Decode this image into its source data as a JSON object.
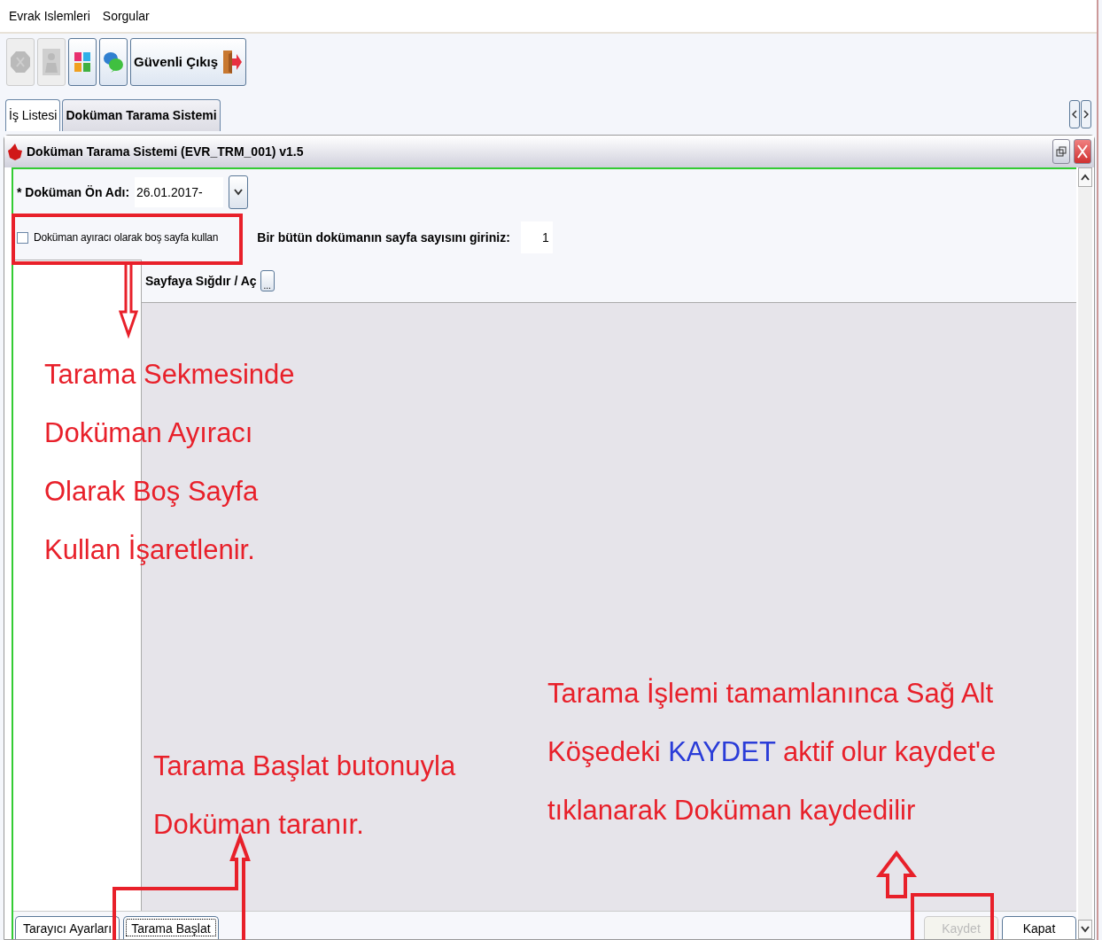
{
  "menu": [
    {
      "label": "Evrak Islemleri"
    },
    {
      "label": "Sorgular"
    }
  ],
  "toolbar": [
    {
      "kind": "icon",
      "disabled": true
    },
    {
      "kind": "icon",
      "disabled": true
    },
    {
      "kind": "icon",
      "disabled": false
    },
    {
      "kind": "icon",
      "disabled": false
    },
    {
      "kind": "labeled",
      "label": "Güvenli Çıkış",
      "disabled": false
    }
  ],
  "tabs": [
    {
      "label": "İş Listesi",
      "selected": false
    },
    {
      "label": "Doküman Tarama Sistemi",
      "selected": true
    }
  ],
  "window": {
    "title": "Doküman Tarama Sistemi (EVR_TRM_001) v1.5"
  },
  "form": {
    "prefix_label": "* Doküman Ön Adı:",
    "prefix_value": "26.01.2017-",
    "separator_checkbox": {
      "label": "Doküman ayıracı olarak boş sayfa kullan",
      "checked": false
    },
    "page_count_label": "Bir bütün dokümanın sayfa sayısını giriniz:",
    "page_count_value": "1",
    "fit_label": "Sayfaya Sığdır / Aç",
    "fit_button": "..."
  },
  "bottom_left_buttons": [
    {
      "label": "Tarayıcı Ayarları",
      "focused": false
    },
    {
      "label": "Tarama Başlat",
      "focused": true
    }
  ],
  "bottom_right_buttons": [
    {
      "label": "Kaydet",
      "disabled": true
    },
    {
      "label": "Kapat",
      "disabled": false
    }
  ],
  "annotations": [
    {
      "segments": [
        {
          "text": "Tarama Sekmesinde Doküman Ayıracı Olarak Boş Sayfa Kullan İşaretlenir.",
          "highlight": false
        }
      ]
    },
    {
      "segments": [
        {
          "text": "Tarama Başlat butonuyla Doküman taranır.",
          "highlight": false
        }
      ]
    },
    {
      "segments": [
        {
          "text": "Tarama İşlemi tamamlanınca Sağ Alt Köşedeki ",
          "highlight": false
        },
        {
          "text": "KAYDET",
          "highlight": true
        },
        {
          "text": " aktif olur kaydet'e tıklanarak Doküman kaydedilir",
          "highlight": false
        }
      ]
    }
  ]
}
